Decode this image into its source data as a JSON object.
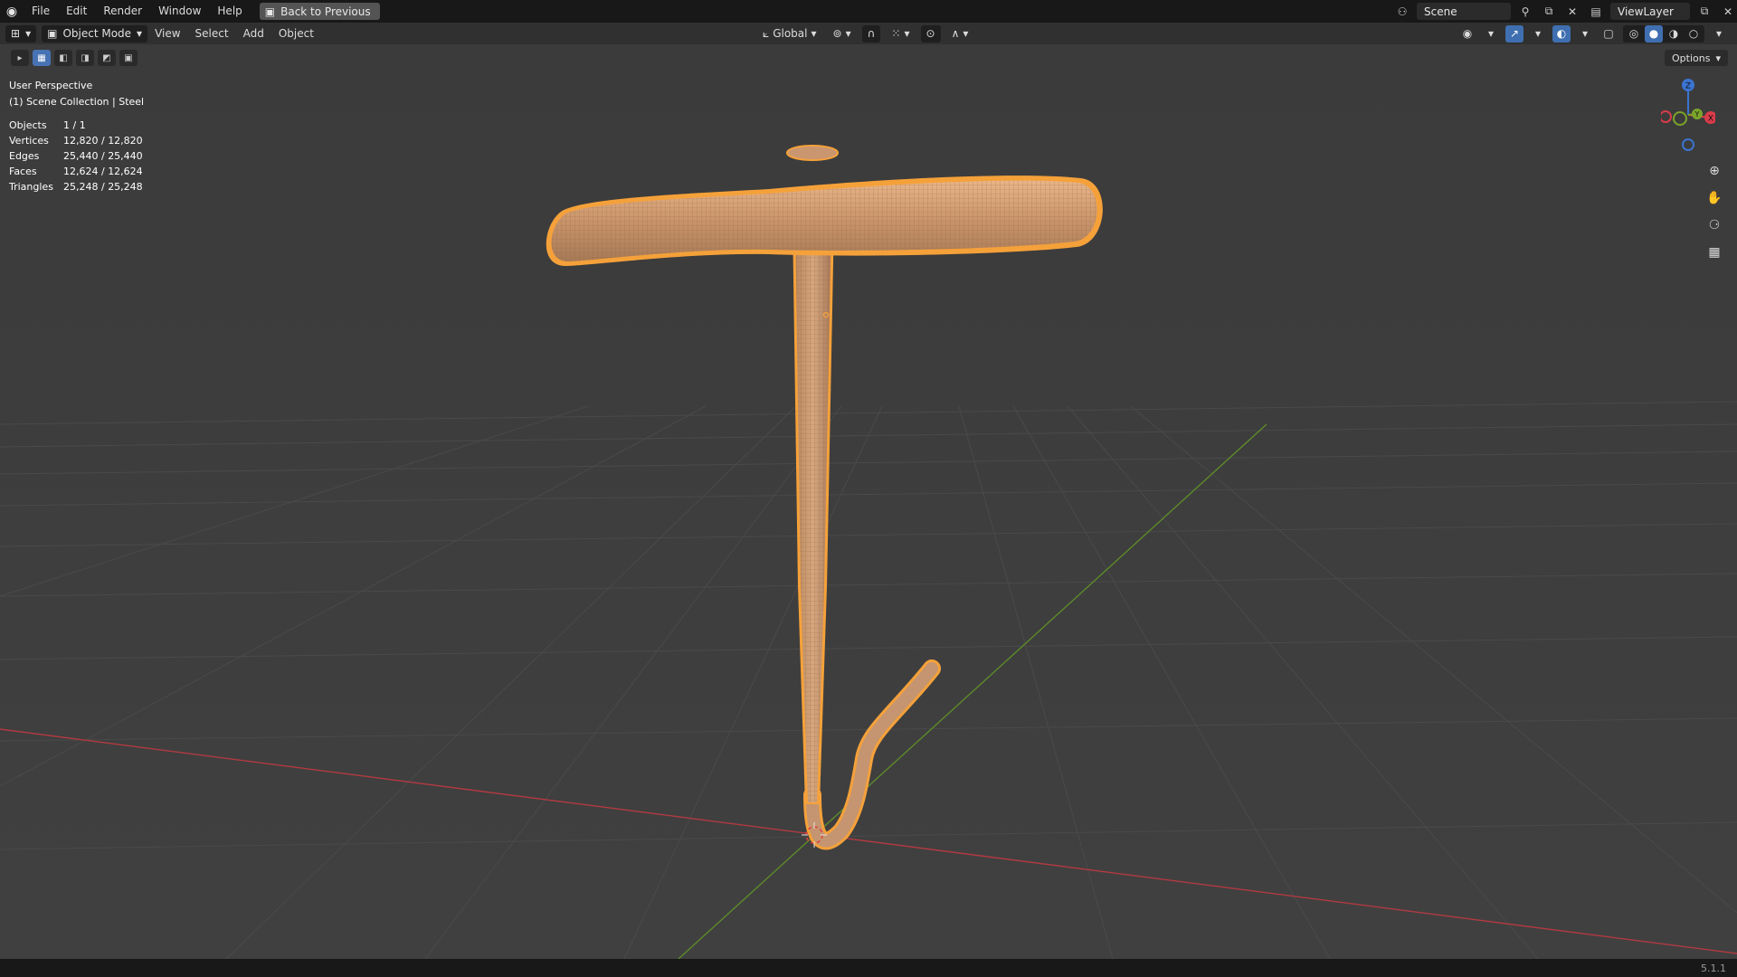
{
  "topbar": {
    "menus": [
      "File",
      "Edit",
      "Render",
      "Window",
      "Help"
    ],
    "back_button": "Back to Previous",
    "scene": "Scene",
    "view_layer": "ViewLayer"
  },
  "header": {
    "mode": "Object Mode",
    "menus": [
      "View",
      "Select",
      "Add",
      "Object"
    ],
    "transform_orientation": "Global"
  },
  "options_label": "Options",
  "viewport": {
    "perspective": "User Perspective",
    "collection": "(1) Scene Collection | Steel"
  },
  "stats": [
    {
      "label": "Objects",
      "value": "1 / 1"
    },
    {
      "label": "Vertices",
      "value": "12,820 / 12,820"
    },
    {
      "label": "Edges",
      "value": "25,440 / 25,440"
    },
    {
      "label": "Faces",
      "value": "12,624 / 12,624"
    },
    {
      "label": "Triangles",
      "value": "25,248 / 25,248"
    }
  ],
  "gizmo": {
    "x": "X",
    "y": "Y",
    "z": "Z"
  },
  "version": "5.1.1",
  "colors": {
    "selection_orange": "#f5a13a",
    "x_axis": "#d83c4a",
    "y_axis": "#7aa52a",
    "z_axis": "#3b74d0"
  }
}
